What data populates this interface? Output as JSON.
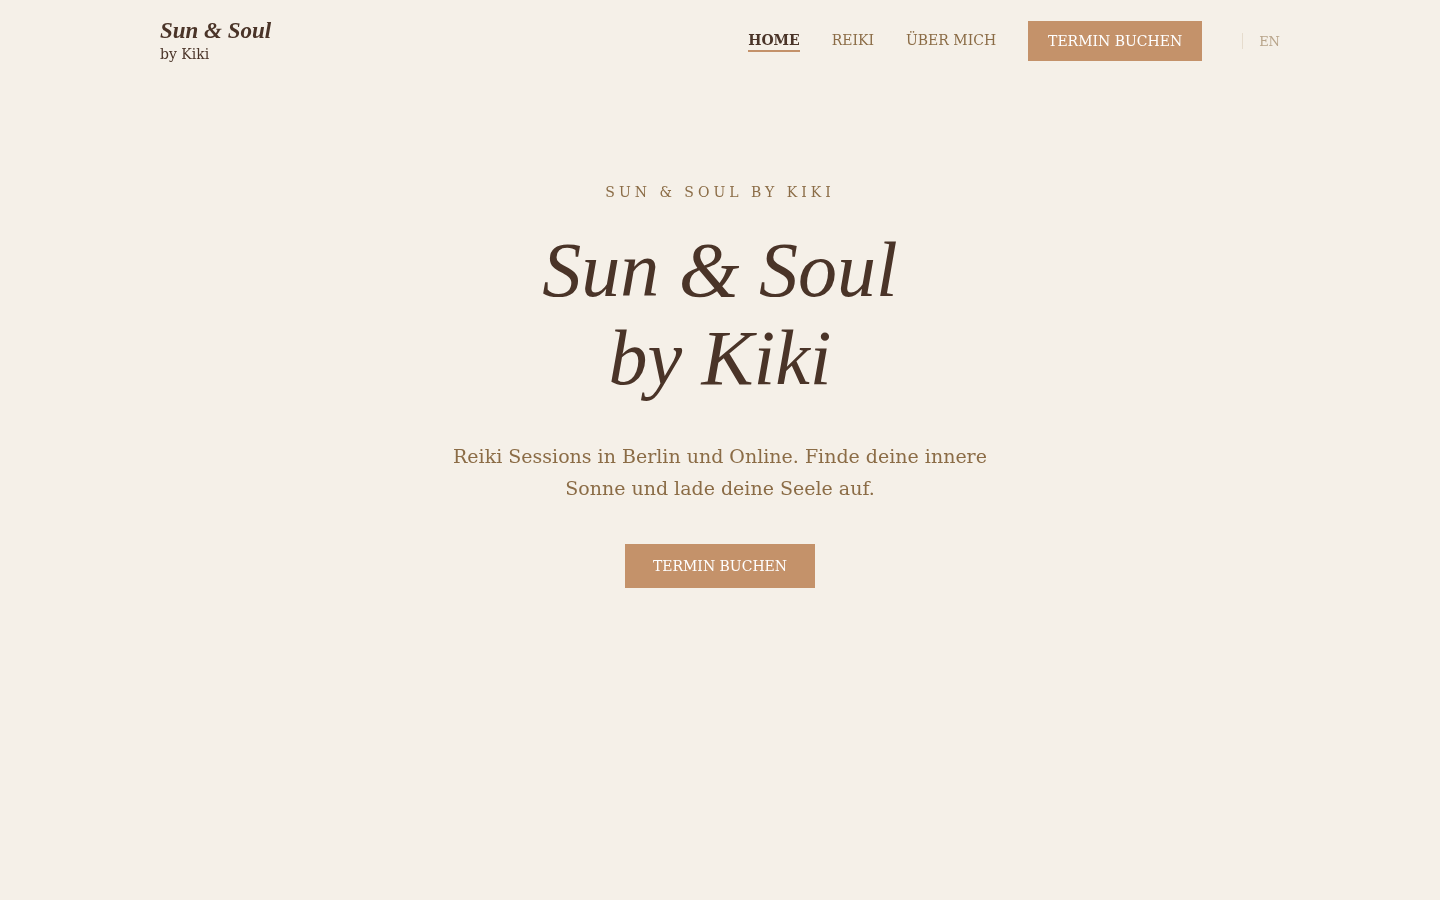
{
  "header": {
    "logo_title": "Sun & Soul",
    "logo_subtitle": "by Kiki",
    "nav": [
      {
        "label": "HOME",
        "selected": true
      },
      {
        "label": "REIKI",
        "selected": false
      },
      {
        "label": "ÜBER MICH",
        "selected": false
      }
    ],
    "cta": "TERMIN BUCHEN",
    "language": "EN"
  },
  "hero": {
    "eyebrow": "SUN & SOUL BY KIKI",
    "title_line_1": "Sun & Soul",
    "title_line_2": "by Kiki",
    "lead": "Reiki Sessions in Berlin und Online. Finde deine innere Sonne und lade deine Seele auf.",
    "button": "TERMIN BUCHEN"
  }
}
